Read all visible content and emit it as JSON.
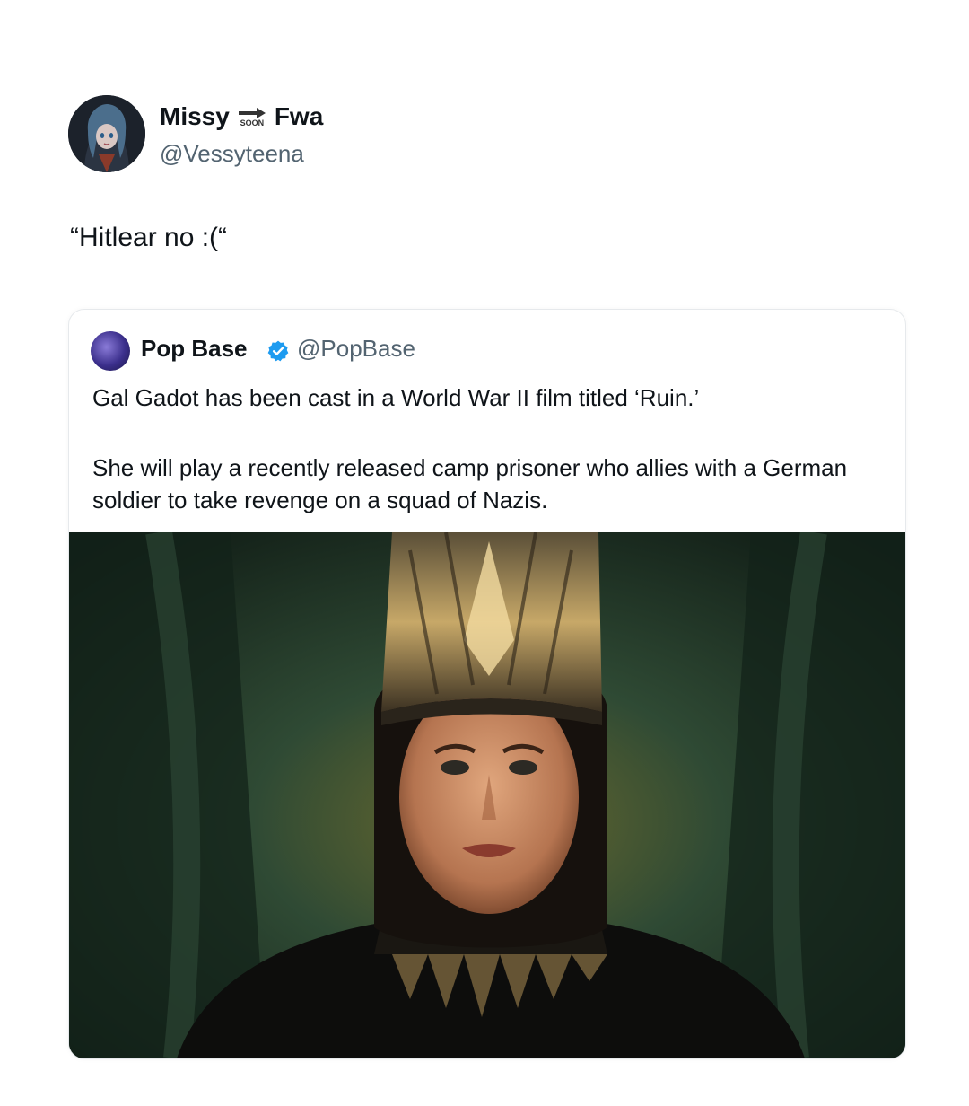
{
  "tweet": {
    "display_name_part1": "Missy",
    "badge_text": "SOON",
    "display_name_part2": "Fwa",
    "handle": "@Vessyteena",
    "text": "“Hitlear no :(“"
  },
  "quote": {
    "display_name": "Pop Base",
    "handle": "@PopBase",
    "text_paragraph_1": "Gal Gadot has been cast in a World War II film titled ‘Ruin.’",
    "text_paragraph_2": "She will play a recently released camp prisoner who allies with a German soldier to take revenge on a squad of Nazis."
  },
  "colors": {
    "text_primary": "#0f1419",
    "text_secondary": "#536471",
    "verified_blue": "#1d9bf0"
  },
  "icons": [
    "soon-arrow-icon",
    "verified-badge-icon"
  ]
}
